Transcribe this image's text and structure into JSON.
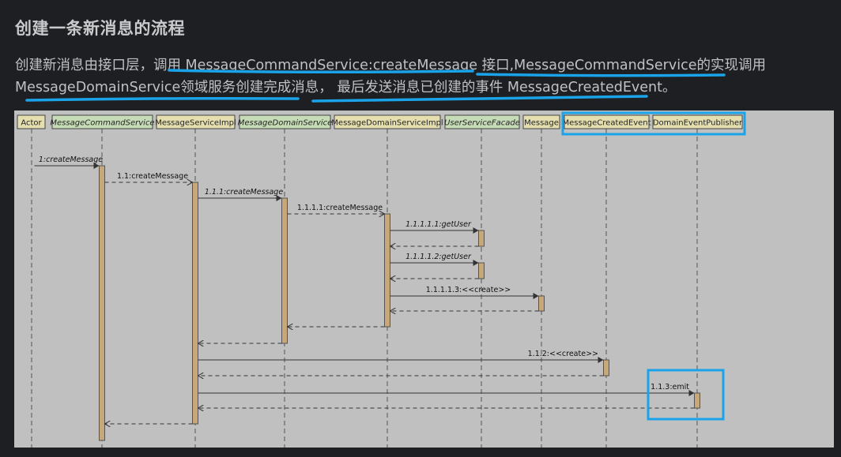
{
  "page": {
    "heading": "创建一条新消息的流程",
    "paragraph_line1": "创建新消息由接口层，调用 MessageCommandService:createMessage 接口,MessageCommandService的实现调用",
    "paragraph_line2": "MessageDomainService领域服务创建完成消息， 最后发送消息已创建的事件 MessageCreatedEvent。"
  },
  "colors": {
    "page_bg": "#1e1f22",
    "diagram_bg": "#c0c0c0",
    "header_fill": "#e5dfb0",
    "interface_fill": "#c6dcb6",
    "activation_fill": "#c8a878",
    "highlight": "#1aa3e8"
  },
  "participants": [
    {
      "id": "actor",
      "label": "Actor",
      "italic": false,
      "kind": "class"
    },
    {
      "id": "mcs",
      "label": "MessageCommandService",
      "italic": true,
      "kind": "interface"
    },
    {
      "id": "msi",
      "label": "MessageServiceImpl",
      "italic": false,
      "kind": "class"
    },
    {
      "id": "mds",
      "label": "MessageDomainService",
      "italic": true,
      "kind": "interface"
    },
    {
      "id": "mdsi",
      "label": "MessageDomainServiceImpl",
      "italic": false,
      "kind": "class"
    },
    {
      "id": "usf",
      "label": "UserServiceFacade",
      "italic": true,
      "kind": "interface"
    },
    {
      "id": "msg",
      "label": "Message",
      "italic": false,
      "kind": "class"
    },
    {
      "id": "mce",
      "label": "MessageCreatedEvent",
      "italic": false,
      "kind": "class"
    },
    {
      "id": "dep",
      "label": "DomainEventPublisher",
      "italic": false,
      "kind": "class"
    }
  ],
  "messages": [
    {
      "from": "actor",
      "to": "mcs",
      "label": "1:createMessage",
      "italic": true,
      "return": false
    },
    {
      "from": "mcs",
      "to": "msi",
      "label": "1.1:createMessage",
      "italic": false,
      "return": true
    },
    {
      "from": "msi",
      "to": "mds",
      "label": "1.1.1:createMessage",
      "italic": true,
      "return": false
    },
    {
      "from": "mds",
      "to": "mdsi",
      "label": "1.1.1.1:createMessage",
      "italic": false,
      "return": true
    },
    {
      "from": "mdsi",
      "to": "usf",
      "label": "1.1.1.1.1:getUser",
      "italic": true,
      "return": false
    },
    {
      "from": "usf",
      "to": "mdsi",
      "label": "",
      "italic": false,
      "return": true
    },
    {
      "from": "mdsi",
      "to": "usf",
      "label": "1.1.1.1.2:getUser",
      "italic": true,
      "return": false
    },
    {
      "from": "usf",
      "to": "mdsi",
      "label": "",
      "italic": false,
      "return": true
    },
    {
      "from": "mdsi",
      "to": "msg",
      "label": "1.1.1.1.3:<<create>>",
      "italic": false,
      "return": false
    },
    {
      "from": "msg",
      "to": "mdsi",
      "label": "",
      "italic": false,
      "return": true
    },
    {
      "from": "mdsi",
      "to": "mds",
      "label": "",
      "italic": false,
      "return": true
    },
    {
      "from": "mds",
      "to": "msi",
      "label": "",
      "italic": false,
      "return": true
    },
    {
      "from": "msi",
      "to": "mce",
      "label": "1.1.2:<<create>>",
      "italic": false,
      "return": false
    },
    {
      "from": "mce",
      "to": "msi",
      "label": "",
      "italic": false,
      "return": true
    },
    {
      "from": "msi",
      "to": "dep",
      "label": "1.1.3:emit",
      "italic": false,
      "return": false
    },
    {
      "from": "dep",
      "to": "msi",
      "label": "",
      "italic": false,
      "return": true
    },
    {
      "from": "msi",
      "to": "mcs",
      "label": "",
      "italic": false,
      "return": true
    }
  ]
}
